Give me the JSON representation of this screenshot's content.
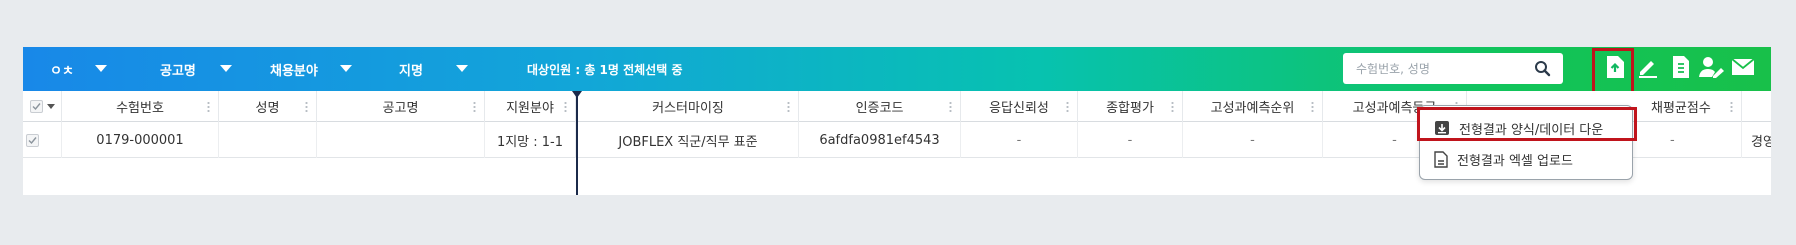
{
  "toolbar": {
    "filters": [
      {
        "label": "ㅇㅊ"
      },
      {
        "label": "공고명"
      },
      {
        "label": "채용분야"
      },
      {
        "label": "지명"
      }
    ],
    "summary": "대상인원 : 총 1명 전체선택 중",
    "search_placeholder": "수험번호, 성명",
    "icons": [
      "file-upload-icon",
      "pen-icon",
      "document-icon",
      "user-edit-icon",
      "mail-icon"
    ]
  },
  "table": {
    "columns": [
      "수험번호",
      "성명",
      "공고명",
      "지원분야",
      "커스터마이징",
      "인증코드",
      "응답신뢰성",
      "종합평가",
      "고성과예측순위",
      "고성과예측등급",
      "채평균점수",
      ""
    ],
    "rows": [
      [
        "0179-000001",
        "",
        "",
        "1지망 : 1-1",
        "JOBFLEX 직군/직무 표준",
        "6afdfa0981ef4543",
        "-",
        "-",
        "-",
        "-",
        "-",
        "경영"
      ]
    ]
  },
  "dropdown": {
    "items": [
      {
        "label": "전형결과 양식/데이터 다운",
        "icon": "download-icon"
      },
      {
        "label": "전형결과 엑셀 업로드",
        "icon": "file-upload-icon"
      }
    ]
  },
  "colors": {
    "toolbar_start": "#1888e8",
    "toolbar_end": "#18c04a",
    "highlight": "#c0141c"
  }
}
